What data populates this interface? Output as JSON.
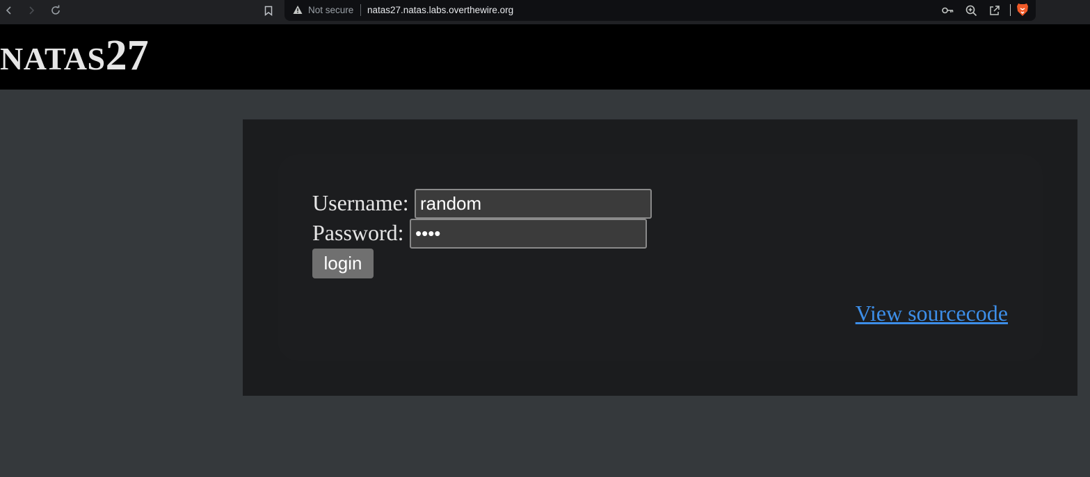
{
  "browser": {
    "security_label": "Not secure",
    "url": "natas27.natas.labs.overthewire.org",
    "icons": {
      "back": "chevron-left",
      "forward": "chevron-right",
      "reload": "reload",
      "bookmark": "bookmark",
      "security": "warning-triangle",
      "password_key": "key",
      "zoom": "zoom-in",
      "share": "share",
      "brave": "brave-lion"
    }
  },
  "header": {
    "title_prefix": "NATAS",
    "title_number": "27"
  },
  "form": {
    "username_label": "Username:",
    "username_value": "random",
    "password_label": "Password:",
    "password_value": "••••",
    "login_label": "login"
  },
  "links": {
    "view_source": "View sourcecode"
  },
  "colors": {
    "page_bg": "#35393c",
    "header_bg": "#000000",
    "panel_bg": "#1b1c1e",
    "link": "#3d8ee8",
    "button_bg": "#707070"
  }
}
